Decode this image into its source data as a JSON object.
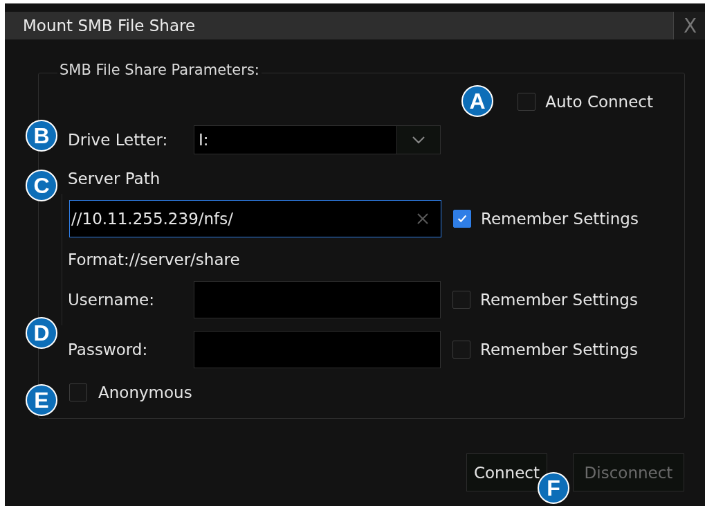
{
  "window": {
    "title": "Mount SMB File Share",
    "close": "X"
  },
  "group": {
    "legend": "SMB File Share Parameters:"
  },
  "auto_connect": {
    "label": "Auto Connect",
    "checked": false
  },
  "drive_letter": {
    "label": "Drive Letter:",
    "value": "I:"
  },
  "server_path": {
    "label": "Server Path",
    "value": "//10.11.255.239/nfs/",
    "focused": true,
    "remember": {
      "label": "Remember Settings",
      "checked": true
    }
  },
  "format_hint": "Format://server/share",
  "credentials": [
    {
      "label": "Username:",
      "remember": {
        "label": "Remember Settings",
        "checked": false
      }
    },
    {
      "label": "Password:",
      "remember": {
        "label": "Remember Settings",
        "checked": false
      }
    }
  ],
  "anonymous": {
    "label": "Anonymous",
    "checked": false
  },
  "buttons": [
    {
      "label": "Connect",
      "disabled": false
    },
    {
      "label": "Disconnect",
      "disabled": true
    }
  ],
  "callouts": [
    "A",
    "B",
    "C",
    "D",
    "E",
    "F"
  ]
}
